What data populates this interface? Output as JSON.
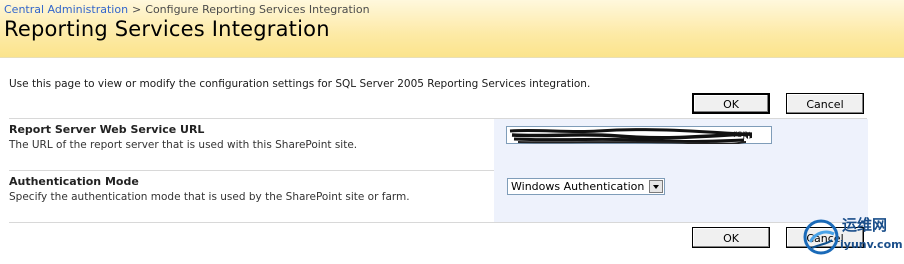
{
  "breadcrumb": {
    "root": "Central Administration",
    "separator": ">",
    "current": "Configure Reporting Services Integration"
  },
  "page_title": "Reporting Services Integration",
  "description": "Use this page to view or modify the configuration settings for SQL Server 2005 Reporting Services integration.",
  "buttons": {
    "ok_label": "OK",
    "cancel_label": "Cancel"
  },
  "sections": {
    "report_server": {
      "title": "Report Server Web Service URL",
      "description": "The URL of the report server that is used with this SharePoint site.",
      "value_visible_suffix": "rsp"
    },
    "auth_mode": {
      "title": "Authentication Mode",
      "description": "Specify the authentication mode that is used by the SharePoint site or farm.",
      "selected": "Windows Authentication"
    }
  },
  "watermark": {
    "cn_text": "运维网",
    "url_text": "iyunv.com"
  },
  "colors": {
    "header_bg": "#fbe48c",
    "breadcrumb_link": "#3366cc",
    "input_panel_bg": "#eef2fc"
  }
}
